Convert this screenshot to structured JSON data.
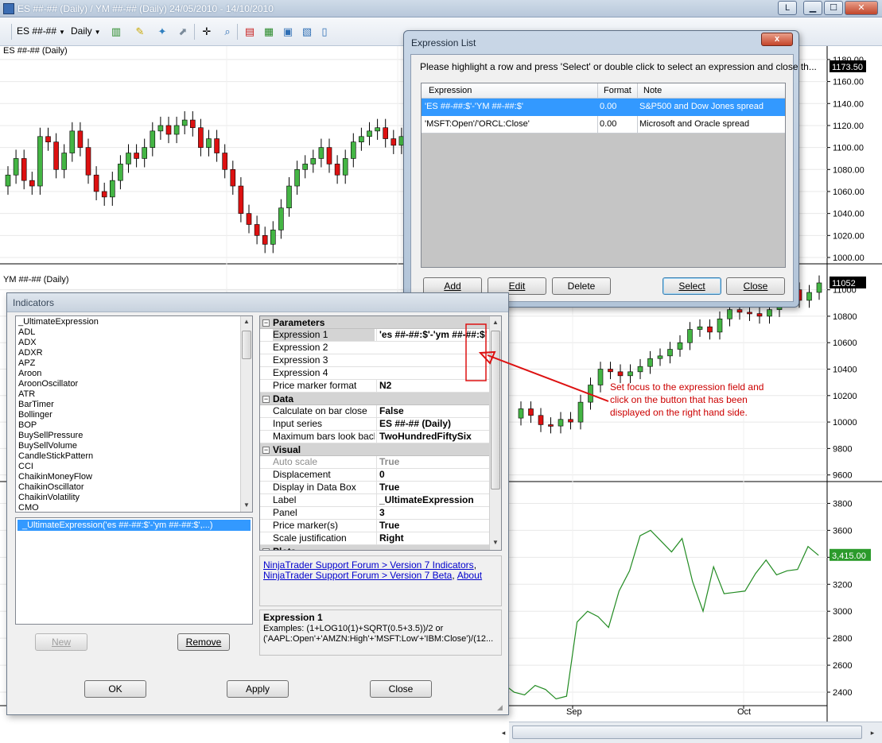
{
  "window": {
    "title": "ES ##-## (Daily) / YM ##-## (Daily)  24/05/2010 - 14/10/2010",
    "buttons": [
      "L",
      "▁",
      "☐",
      "✕"
    ]
  },
  "toolbar": {
    "instrument": "ES ##-##",
    "interval": "Daily"
  },
  "chart": {
    "panels": [
      {
        "label": "ES ##-## (Daily)",
        "price_marker": "1173.50"
      },
      {
        "label": "YM ##-## (Daily)",
        "price_marker": "11052"
      },
      {
        "label": "",
        "price_marker": "3,415.00"
      }
    ],
    "es_axis": [
      "1180.00",
      "1160.00",
      "1140.00",
      "1120.00",
      "1100.00",
      "1080.00",
      "1060.00",
      "1040.00",
      "1020.00",
      "1000.00"
    ],
    "ym_axis": [
      "11000",
      "10800",
      "10600",
      "10400",
      "10200",
      "10000",
      "9800",
      "9600"
    ],
    "spread_axis": [
      "3800",
      "3600",
      "3400",
      "3200",
      "3000",
      "2800",
      "2600",
      "2400"
    ],
    "x_labels": [
      "Sep",
      "Oct"
    ],
    "colors": {
      "up": "#44b544",
      "down": "#dd1111",
      "line": "#228b22"
    }
  },
  "chart_data": [
    {
      "type": "candlestick",
      "title": "ES ##-## (Daily)",
      "ylim": [
        1000,
        1185
      ],
      "last": 1173.5,
      "close_values": [
        1075,
        1090,
        1070,
        1065,
        1110,
        1105,
        1080,
        1095,
        1115,
        1100,
        1075,
        1060,
        1055,
        1070,
        1085,
        1095,
        1090,
        1100,
        1115,
        1120,
        1112,
        1120,
        1125,
        1118,
        1100,
        1108,
        1095,
        1080,
        1065,
        1040,
        1030,
        1020,
        1012,
        1025,
        1045,
        1065,
        1080,
        1085,
        1090,
        1100,
        1085,
        1075,
        1090,
        1105,
        1110,
        1115,
        1118,
        1108,
        1102,
        1110,
        1125
      ]
    },
    {
      "type": "candlestick",
      "title": "YM ##-## (Daily)",
      "ylim": [
        9550,
        11100
      ],
      "last": 11052,
      "close_values": [
        10100,
        10050,
        9980,
        9970,
        10020,
        10000,
        10150,
        10280,
        10400,
        10380,
        10350,
        10380,
        10420,
        10480,
        10500,
        10550,
        10600,
        10700,
        10720,
        10680,
        10780,
        10850,
        10830,
        10820,
        10800,
        10850,
        10950,
        11000,
        10920,
        10980,
        11052
      ]
    },
    {
      "type": "line",
      "title": "",
      "ylim": [
        2300,
        3950
      ],
      "last": 3415,
      "values": [
        2450,
        2460,
        2400,
        2380,
        2450,
        2420,
        2350,
        2370,
        2920,
        3000,
        2960,
        2880,
        3150,
        3300,
        3560,
        3600,
        3520,
        3440,
        3540,
        3220,
        3000,
        3330,
        3130,
        3140,
        3150,
        3280,
        3380,
        3270,
        3300,
        3310,
        3480,
        3415
      ]
    }
  ],
  "expression_list": {
    "title": "Expression List",
    "close_label": "x",
    "instruction": "Please highlight a row and press 'Select' or double click to select an expression and close th...",
    "headers": [
      "Expression",
      "Format",
      "Note"
    ],
    "rows": [
      {
        "expression": "'ES ##-##:$'-'YM ##-##:$'",
        "format": "0.00",
        "note": "S&P500 and Dow Jones spread"
      },
      {
        "expression": "'MSFT:Open'/'ORCL:Close'",
        "format": "0.00",
        "note": "Microsoft and Oracle spread"
      }
    ],
    "buttons": {
      "add": "Add",
      "edit": "Edit",
      "delete": "Delete",
      "select": "Select",
      "close": "Close"
    }
  },
  "indicators": {
    "title": "Indicators",
    "available": [
      "_UltimateExpression",
      "ADL",
      "ADX",
      "ADXR",
      "APZ",
      "Aroon",
      "AroonOscillator",
      "ATR",
      "BarTimer",
      "Bollinger",
      "BOP",
      "BuySellPressure",
      "BuySellVolume",
      "CandleStickPattern",
      "CCI",
      "ChaikinMoneyFlow",
      "ChaikinOscillator",
      "ChaikinVolatility",
      "CMO"
    ],
    "applied": "_UltimateExpression('es ##-##:$'-'ym ##-##:$',...)",
    "new_label": "New",
    "remove_label": "Remove",
    "groups": {
      "parameters": "Parameters",
      "data": "Data",
      "visual": "Visual",
      "plots": "Plots"
    },
    "parameters": [
      {
        "name": "Expression 1",
        "value": "'es ##-##:$'-'ym ##-##:$'"
      },
      {
        "name": "Expression 2",
        "value": ""
      },
      {
        "name": "Expression 3",
        "value": ""
      },
      {
        "name": "Expression 4",
        "value": ""
      },
      {
        "name": "Price marker format",
        "value": "N2"
      }
    ],
    "data": [
      {
        "name": "Calculate on bar close",
        "value": "False"
      },
      {
        "name": "Input series",
        "value": "ES ##-## (Daily)"
      },
      {
        "name": "Maximum bars look back",
        "value": "TwoHundredFiftySix"
      }
    ],
    "visual": [
      {
        "name": "Auto scale",
        "value": "True"
      },
      {
        "name": "Displacement",
        "value": "0"
      },
      {
        "name": "Display in Data Box",
        "value": "True"
      },
      {
        "name": "Label",
        "value": "_UltimateExpression"
      },
      {
        "name": "Panel",
        "value": "3"
      },
      {
        "name": "Price marker(s)",
        "value": "True"
      },
      {
        "name": "Scale justification",
        "value": "Right"
      }
    ],
    "links": {
      "line1_a": "NinjaTrader Support Forum > Version 7 Indicators",
      "line1_sep": ",",
      "line2_a": "NinjaTrader Support Forum > Version 7 Beta",
      "line2_sep": ",",
      "line2_b": "About"
    },
    "help": {
      "title": "Expression 1",
      "line1": "Examples: (1+LOG10(1)+SQRT(0.5+3.5))/2 or",
      "line2": "('AAPL:Open'+'AMZN:High'+'MSFT:Low'+'IBM:Close')/(12..."
    },
    "buttons": {
      "ok": "OK",
      "apply": "Apply",
      "close": "Close"
    }
  },
  "annotation": {
    "line1": "Set focus to the expression field and",
    "line2": "click on the button that has been",
    "line3": "displayed on the right hand side.",
    "color": "#cc0000"
  }
}
